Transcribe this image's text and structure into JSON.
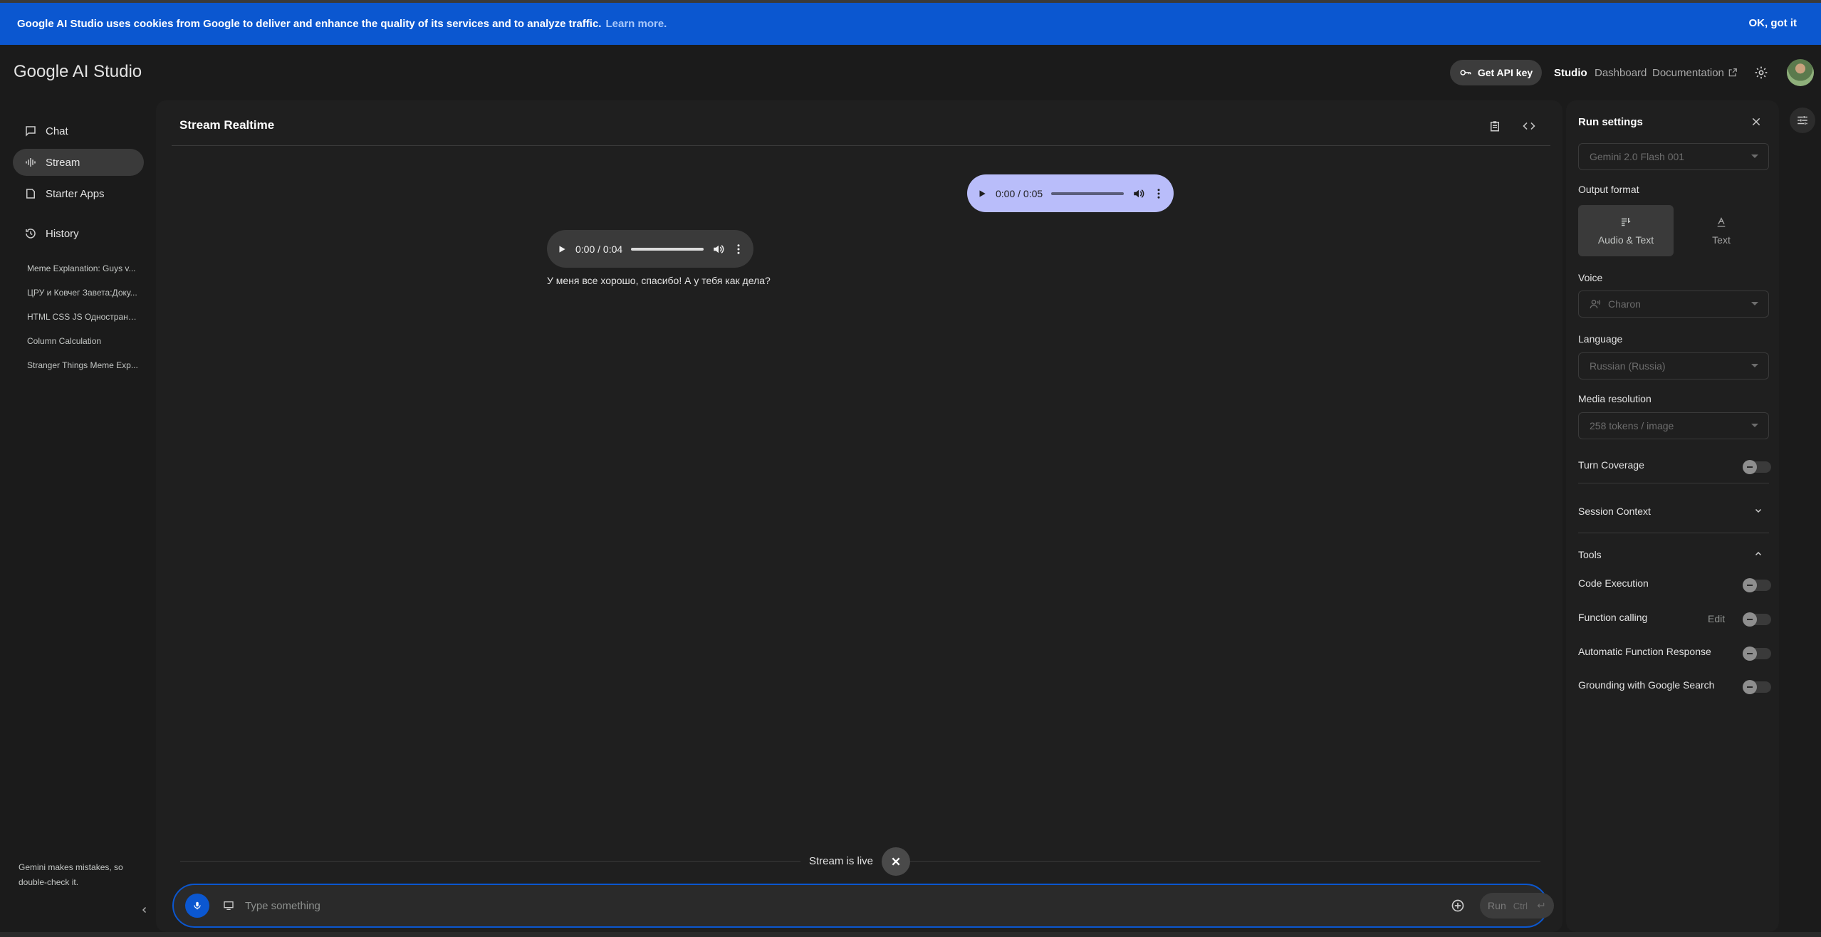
{
  "banner": {
    "text": "Google AI Studio uses cookies from Google to deliver and enhance the quality of its services and to analyze traffic.",
    "learn_more": "Learn more.",
    "ok": "OK, got it"
  },
  "header": {
    "logo": "Google AI Studio",
    "api_key": "Get API key",
    "nav": {
      "studio": "Studio",
      "dashboard": "Dashboard",
      "documentation": "Documentation"
    }
  },
  "sidebar": {
    "items": [
      {
        "label": "Chat",
        "icon": "chat-icon"
      },
      {
        "label": "Stream",
        "icon": "waveform-icon"
      },
      {
        "label": "Starter Apps",
        "icon": "apps-icon"
      }
    ],
    "history_label": "History",
    "history": [
      "Meme Explanation: Guys v...",
      "ЦРУ и Ковчег Завета:Доку...",
      "HTML CSS JS Одностранич...",
      "Column Calculation",
      "Stranger Things Meme Exp..."
    ],
    "disclaimer": "Gemini makes mistakes, so double-check it."
  },
  "main": {
    "title": "Stream Realtime",
    "user_audio": {
      "time": "0:00 / 0:05"
    },
    "model_audio": {
      "time": "0:00 / 0:04"
    },
    "model_text": "У меня все хорошо, спасибо! А у тебя как дела?",
    "live_status": "Stream is live",
    "input": {
      "placeholder": "Type something"
    },
    "run": {
      "label": "Run",
      "shortcut": "Ctrl"
    }
  },
  "settings": {
    "title": "Run settings",
    "model": "Gemini 2.0 Flash 001",
    "output_format_label": "Output format",
    "formats": [
      "Audio & Text",
      "Text"
    ],
    "voice_label": "Voice",
    "voice": "Charon",
    "language_label": "Language",
    "language": "Russian (Russia)",
    "media_label": "Media resolution",
    "media": "258 tokens / image",
    "turn_coverage": "Turn Coverage",
    "session_context": "Session Context",
    "tools_label": "Tools",
    "tools": {
      "code_execution": "Code Execution",
      "function_calling": "Function calling",
      "edit": "Edit",
      "auto_function": "Automatic Function Response",
      "grounding": "Grounding with Google Search"
    }
  },
  "colors": {
    "accent": "#0b57d0",
    "user_bubble": "#b9bdfa",
    "background": "#1b1b1b",
    "panel": "#1f1f1f"
  }
}
